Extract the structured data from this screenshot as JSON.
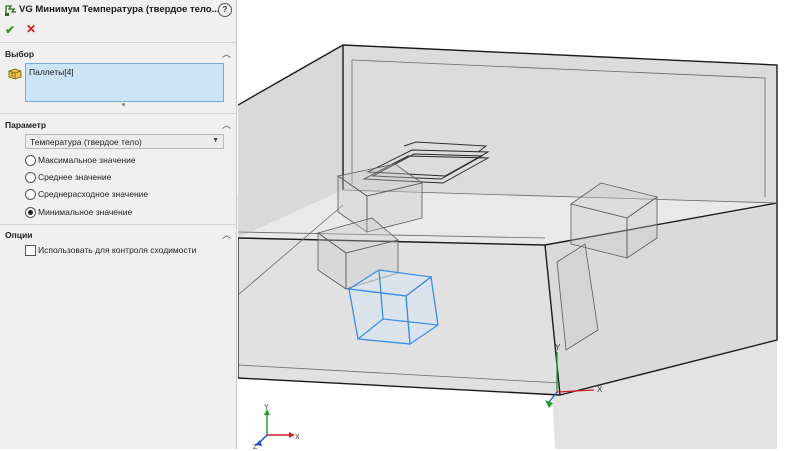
{
  "panel": {
    "title": "VG Минимум Температура (твердое тело...",
    "help_symbol": "?",
    "ok_symbol": "✔",
    "cancel_symbol": "✕"
  },
  "selection": {
    "header": "Выбор",
    "items": [
      "Паллеты[4]"
    ]
  },
  "parameter": {
    "header": "Параметр",
    "dropdown_value": "Температура (твердое тело)",
    "options": [
      {
        "label": "Максимальное значение",
        "checked": false
      },
      {
        "label": "Среднее значение",
        "checked": false
      },
      {
        "label": "Среднерасходное значение",
        "checked": false
      },
      {
        "label": "Минимальное значение",
        "checked": true
      }
    ]
  },
  "options": {
    "header": "Опции",
    "convergence_label": "Использовать для контроля сходимости",
    "convergence_checked": false
  },
  "viewport": {
    "triad_main": {
      "x": "X",
      "y": "Y",
      "z": "Z"
    },
    "triad_small": {
      "x": "X",
      "y": "Y",
      "z": "Z"
    },
    "colors": {
      "selected_edge": "#3d8ee6",
      "axis_x": "#d02020",
      "axis_y": "#20a030",
      "axis_z": "#2050d0"
    }
  }
}
